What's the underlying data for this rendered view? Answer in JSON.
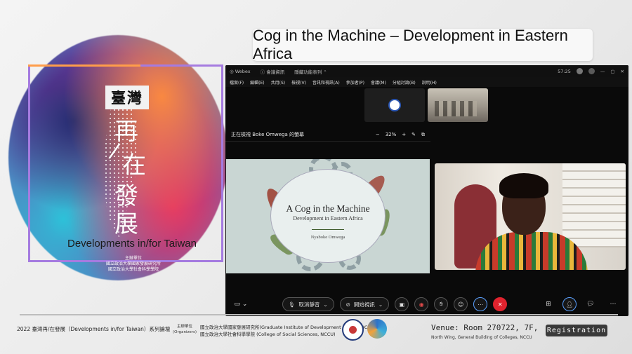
{
  "brand": {
    "cn_title": "臺灣",
    "cn_char1": "再",
    "cn_slash": "/",
    "cn_char2": "在",
    "cn_char3": "發",
    "cn_char4": "展",
    "en_title": "Developments in/for Taiwan",
    "org_label": "主辦單位",
    "org_line1": "國立政治大學國家發展研究所",
    "org_line2": "國立政治大學社會科學學院"
  },
  "slide_title": "Cog in the Machine – Development in Eastern Africa",
  "webex": {
    "app_name": "Webex",
    "meeting_info": "會議資訊",
    "hide_menu": "隱藏功能表列",
    "clock": "57:25",
    "menu": [
      "檔案(F)",
      "編輯(E)",
      "共用(S)",
      "檢視(V)",
      "音訊和視訊(A)",
      "參加者(P)",
      "會議(M)",
      "分組討論(B)",
      "說明(H)"
    ],
    "share_label": "正在檢視 Boke Omwega 的螢幕",
    "zoom_minus": "−",
    "zoom_level": "32%",
    "zoom_plus": "+",
    "slide": {
      "title": "A Cog in the Machine",
      "subtitle": "Development in Eastern Africa",
      "author": "Nyaboke Omwega"
    },
    "controls": {
      "mute_label": "取消靜音",
      "video_label": "開始視訊"
    }
  },
  "footer": {
    "series": "2022 臺灣再/在發展（Developments in/for Taiwan）系列論壇",
    "org_label": "主辦單位",
    "org_label_en": "(Organizers)",
    "org_line1": "國立政治大學國家發展研究所(Graduate Institute of Development Studies,NCCU)",
    "org_line2": "國立政治大學社會科學學院 (College of Social Sciences, NCCU)",
    "venue": "Venue: Room 270722, 7F,",
    "venue_sub": "North Wing, General Building of Colleges, NCCU",
    "registration": "Registration"
  },
  "colors": {
    "frame": "#a57be0",
    "frame_accent": "#ff9d4a",
    "end_call": "#e0232e",
    "webex_bg": "#0a0a0a"
  }
}
